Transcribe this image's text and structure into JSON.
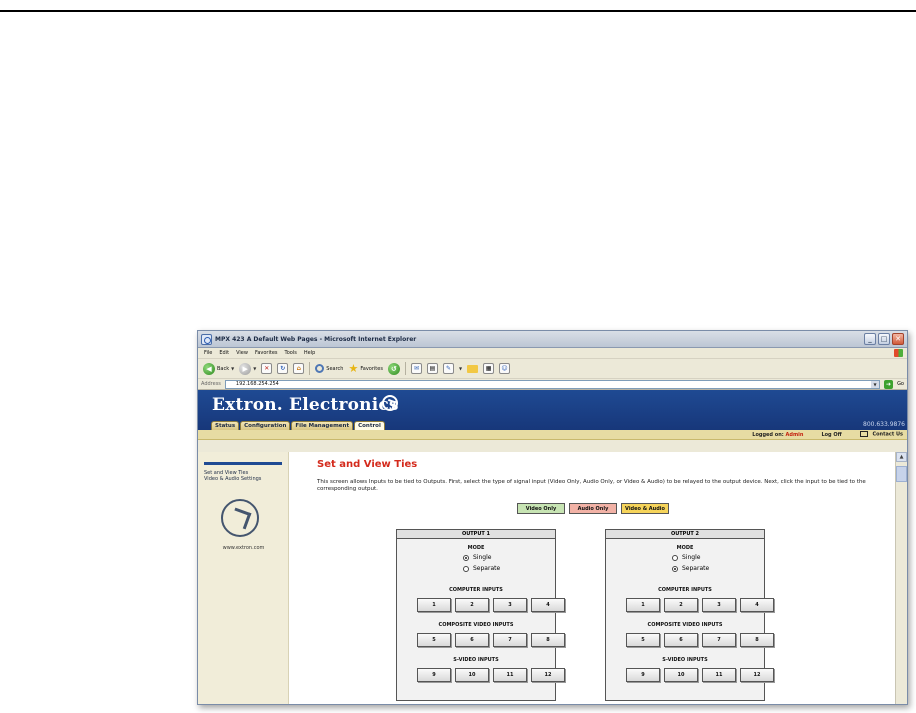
{
  "window": {
    "title": "MPX 423 A Default Web Pages - Microsoft Internet Explorer",
    "buttons": {
      "minimize": "_",
      "maximize": "□",
      "close": "✕"
    }
  },
  "menu": [
    "File",
    "Edit",
    "View",
    "Favorites",
    "Tools",
    "Help"
  ],
  "toolbar": {
    "back_label": "Back",
    "search_label": "Search",
    "favorites_label": "Favorites"
  },
  "address": {
    "label": "Address",
    "value": "192.168.254.254",
    "go_label": "Go"
  },
  "site": {
    "brand": "Extron. Electronics",
    "phone": "800.633.9876",
    "tabs": [
      "Status",
      "Configuration",
      "File Management",
      "Control"
    ],
    "active_tab": "Control",
    "logged_on_label": "Logged on:",
    "logged_on_user": "Admin",
    "log_off": "Log Off",
    "contact": "Contact Us"
  },
  "sidebar": {
    "links": [
      "Set and View Ties",
      "Video & Audio Settings"
    ],
    "url": "www.extron.com"
  },
  "main": {
    "heading": "Set and View Ties",
    "description": "This screen allows Inputs to be tied to Outputs. First, select the type of signal input (Video Only, Audio Only, or Video & Audio) to be relayed to the output device. Next, click the input to be tied to the corresponding output.",
    "signal_buttons": [
      "Video Only",
      "Audio Only",
      "Video & Audio"
    ]
  },
  "outputs": [
    {
      "title": "OUTPUT 1",
      "mode_label": "MODE",
      "modes": [
        "Single",
        "Separate"
      ],
      "selected_mode": "Single",
      "computer_label": "COMPUTER INPUTS",
      "computer_inputs": [
        "1",
        "2",
        "3",
        "4"
      ],
      "composite_label": "COMPOSITE VIDEO INPUTS",
      "composite_inputs": [
        "5",
        "6",
        "7",
        "8"
      ],
      "svideo_label": "S-VIDEO INPUTS",
      "svideo_inputs": [
        "9",
        "10",
        "11",
        "12"
      ]
    },
    {
      "title": "OUTPUT 2",
      "mode_label": "MODE",
      "modes": [
        "Single",
        "Separate"
      ],
      "selected_mode": "Separate",
      "computer_label": "COMPUTER INPUTS",
      "computer_inputs": [
        "1",
        "2",
        "3",
        "4"
      ],
      "composite_label": "COMPOSITE VIDEO INPUTS",
      "composite_inputs": [
        "5",
        "6",
        "7",
        "8"
      ],
      "svideo_label": "S-VIDEO INPUTS",
      "svideo_inputs": [
        "9",
        "10",
        "11",
        "12"
      ]
    }
  ]
}
